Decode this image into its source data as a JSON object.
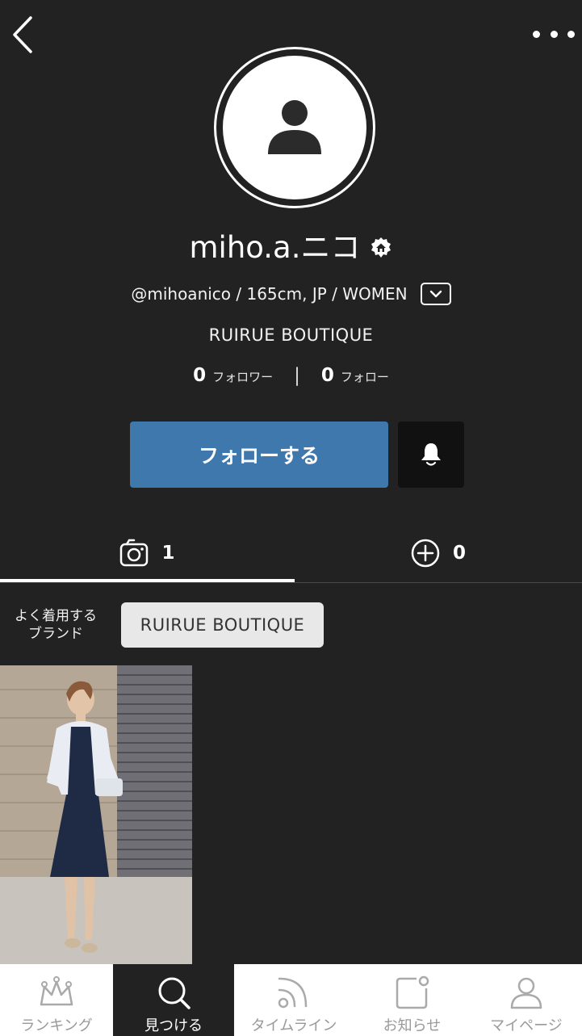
{
  "profile": {
    "username": "miho.a.ニコ",
    "handle_line": "@mihoanico / 165cm, JP / WOMEN",
    "shop": "RUIRUE BOUTIQUE",
    "followers_count": "0",
    "followers_label": "フォロワー",
    "following_count": "0",
    "following_label": "フォロー",
    "separator": "|"
  },
  "actions": {
    "follow_label": "フォローする"
  },
  "tabs": {
    "posts_count": "1",
    "saved_count": "0"
  },
  "brands": {
    "label_line1": "よく着用する",
    "label_line2": "ブランド",
    "chip": "RUIRUE BOUTIQUE"
  },
  "bottom_nav": [
    {
      "label": "ランキング",
      "icon": "crown-icon",
      "active": false
    },
    {
      "label": "見つける",
      "icon": "search-icon",
      "active": true
    },
    {
      "label": "タイムライン",
      "icon": "rss-icon",
      "active": false
    },
    {
      "label": "お知らせ",
      "icon": "notification-icon",
      "active": false
    },
    {
      "label": "マイページ",
      "icon": "person-icon",
      "active": false
    }
  ],
  "colors": {
    "background": "#222222",
    "follow_button": "#3e78ad",
    "bell_button": "#111111",
    "chip": "#e8e8e8"
  }
}
